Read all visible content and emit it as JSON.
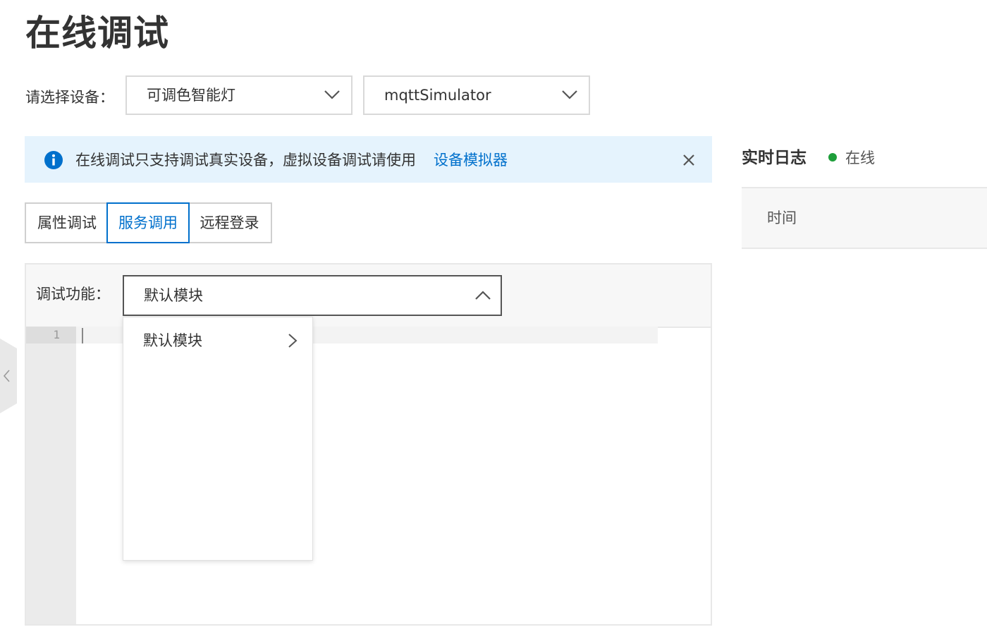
{
  "page": {
    "title": "在线调试"
  },
  "device_selector": {
    "label": "请选择设备：",
    "product_value": "可调色智能灯",
    "device_value": "mqttSimulator",
    "chevron_icon": "chevron-down-icon"
  },
  "notice": {
    "text": "在线调试只支持调试真实设备，虚拟设备调试请使用",
    "link": "设备模拟器",
    "icon": "info-icon",
    "close_icon": "close-icon",
    "bg_color": "#e5f3fd",
    "link_color": "#0070cc"
  },
  "tabs": [
    {
      "label": "属性调试",
      "active": false
    },
    {
      "label": "服务调用",
      "active": true
    },
    {
      "label": "远程登录",
      "active": false
    }
  ],
  "debug": {
    "function_label": "调试功能：",
    "function_value": "默认模块",
    "chevron_icon": "chevron-up-icon",
    "dropdown": {
      "items": [
        {
          "label": "默认模块",
          "icon": "chevron-right-icon"
        }
      ]
    },
    "editor": {
      "line_numbers": [
        "1"
      ]
    }
  },
  "log": {
    "title": "实时日志",
    "status": "在线",
    "status_color": "#1e9e3a",
    "columns": [
      "时间"
    ]
  }
}
